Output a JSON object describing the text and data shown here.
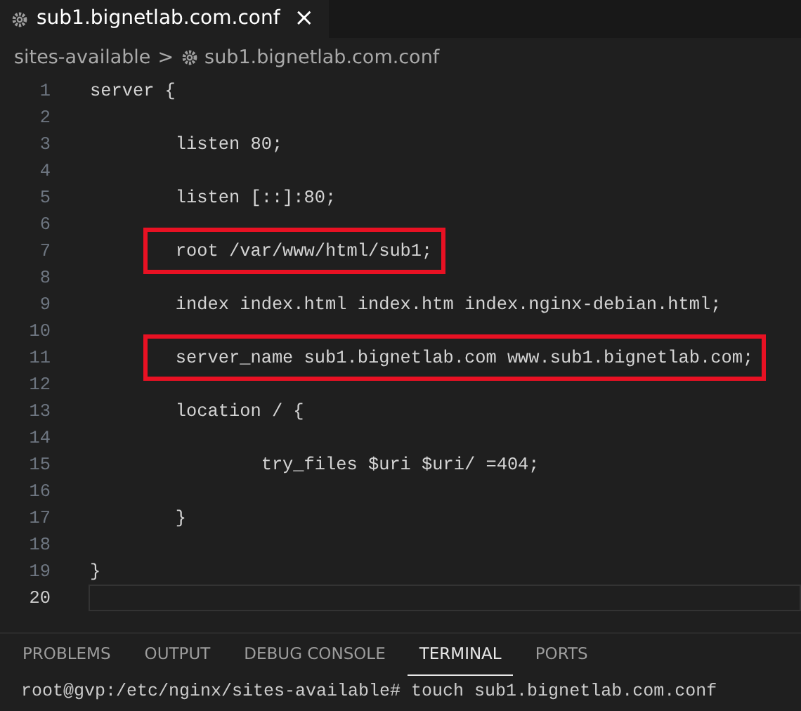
{
  "editor_tab": {
    "title": "sub1.bignetlab.com.conf",
    "close": "×"
  },
  "breadcrumb": {
    "folder": "sites-available",
    "separator": ">",
    "file": "sub1.bignetlab.com.conf"
  },
  "code_lines": [
    {
      "number": "1",
      "text": "server {",
      "current": false,
      "boxed": false
    },
    {
      "number": "2",
      "current": false
    },
    {
      "number": "3",
      "text": "\t\tlisten 80",
      "end": ";",
      "current": false,
      "boxed": false
    },
    {
      "number": "4",
      "current": false
    },
    {
      "number": "5",
      "text": "\t\tlisten [::]:80",
      "end": ";",
      "current": false,
      "boxed": false
    },
    {
      "number": "6",
      "current": false
    },
    {
      "number": "7",
      "text": "\t\troot /var/www/html/sub1",
      "end": ";",
      "current": false,
      "boxed": true
    },
    {
      "number": "8",
      "current": false
    },
    {
      "number": "9",
      "text": "\t\tindex index.html index.htm index.nginx-debian.html",
      "end": ";",
      "current": false,
      "boxed": false
    },
    {
      "number": "10",
      "current": false
    },
    {
      "number": "11",
      "text": "\t\tserver_name sub1.bignetlab.com www.sub1.bignetlab.com",
      "end": ";",
      "current": false,
      "boxed": true
    },
    {
      "number": "12",
      "current": false
    },
    {
      "number": "13",
      "text": "\t\tlocation / {",
      "current": false,
      "boxed": false
    },
    {
      "number": "14",
      "current": false
    },
    {
      "number": "15",
      "text": "\t\t\t\ttry_files $uri $uri/ =404",
      "end": ";",
      "current": false,
      "boxed": false
    },
    {
      "number": "16",
      "current": false
    },
    {
      "number": "17",
      "text": "\t\t}",
      "current": false,
      "boxed": false
    },
    {
      "number": "18",
      "current": false
    },
    {
      "number": "19",
      "text": "}",
      "current": false,
      "boxed": false
    },
    {
      "number": "20",
      "current": true
    }
  ],
  "panel_tabs": [
    {
      "label": "PROBLEMS",
      "selected": false
    },
    {
      "label": "OUTPUT",
      "selected": false
    },
    {
      "label": "DEBUG CONSOLE",
      "selected": false
    },
    {
      "label": "TERMINAL",
      "selected": true
    },
    {
      "label": "PORTS",
      "selected": false
    }
  ],
  "terminal": {
    "lines": [
      "root@gvp:/etc/nginx/sites-available# touch sub1.bignetlab.com.conf"
    ]
  }
}
